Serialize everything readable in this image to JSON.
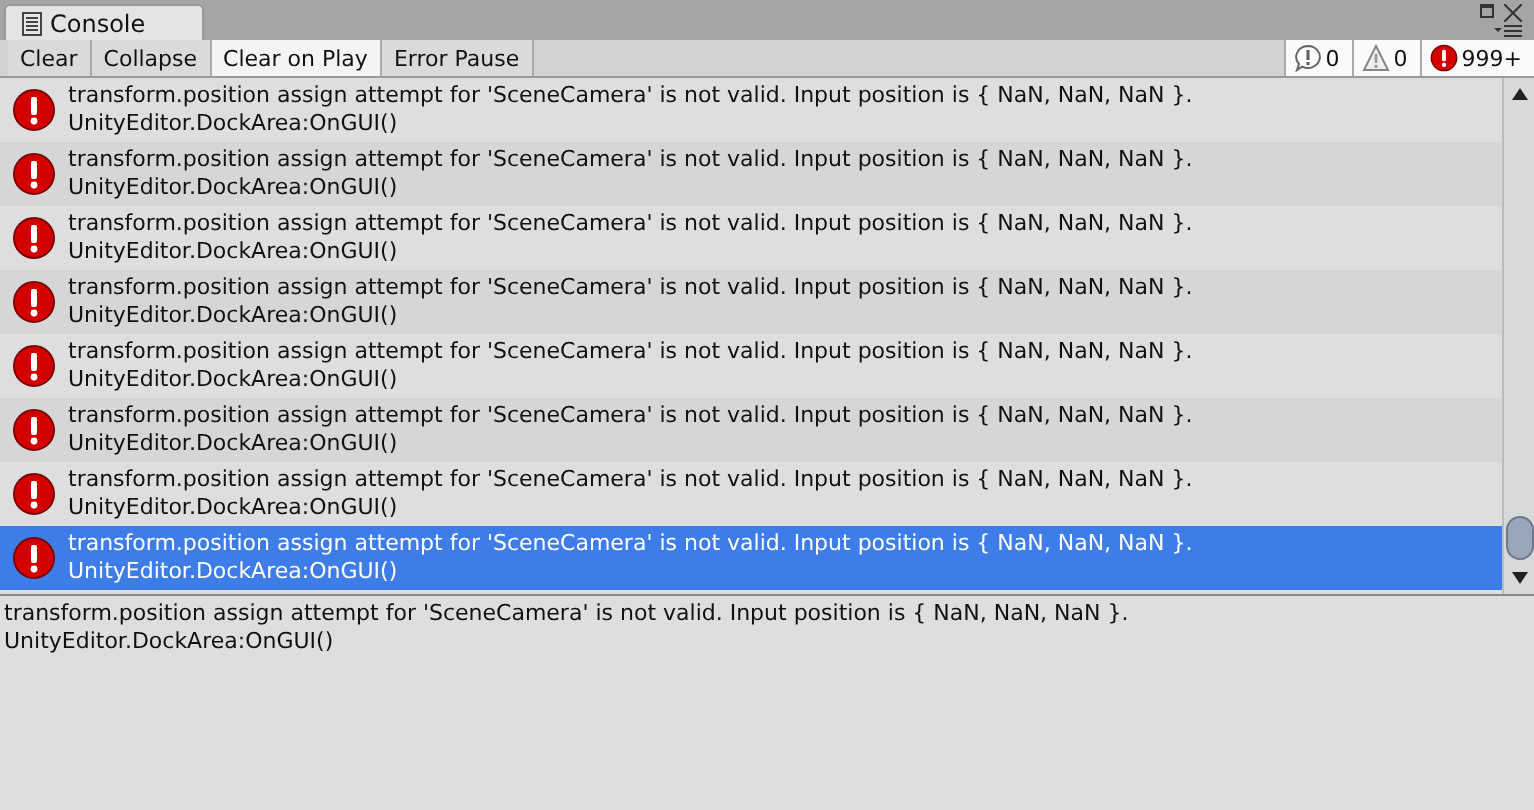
{
  "tab": {
    "title": "Console"
  },
  "toolbar": {
    "buttons": [
      {
        "label": "Clear",
        "selected": false
      },
      {
        "label": "Collapse",
        "selected": false
      },
      {
        "label": "Clear on Play",
        "selected": true
      },
      {
        "label": "Error Pause",
        "selected": false
      }
    ],
    "counters": [
      {
        "kind": "info",
        "count": "0"
      },
      {
        "kind": "warning",
        "count": "0"
      },
      {
        "kind": "error",
        "count": "999+"
      }
    ]
  },
  "entries": [
    {
      "kind": "error",
      "message": "transform.position assign attempt for 'SceneCamera' is not valid. Input position is { NaN, NaN, NaN }.",
      "source": "UnityEditor.DockArea:OnGUI()",
      "selected": false
    },
    {
      "kind": "error",
      "message": "transform.position assign attempt for 'SceneCamera' is not valid. Input position is { NaN, NaN, NaN }.",
      "source": "UnityEditor.DockArea:OnGUI()",
      "selected": false
    },
    {
      "kind": "error",
      "message": "transform.position assign attempt for 'SceneCamera' is not valid. Input position is { NaN, NaN, NaN }.",
      "source": "UnityEditor.DockArea:OnGUI()",
      "selected": false
    },
    {
      "kind": "error",
      "message": "transform.position assign attempt for 'SceneCamera' is not valid. Input position is { NaN, NaN, NaN }.",
      "source": "UnityEditor.DockArea:OnGUI()",
      "selected": false
    },
    {
      "kind": "error",
      "message": "transform.position assign attempt for 'SceneCamera' is not valid. Input position is { NaN, NaN, NaN }.",
      "source": "UnityEditor.DockArea:OnGUI()",
      "selected": false
    },
    {
      "kind": "error",
      "message": "transform.position assign attempt for 'SceneCamera' is not valid. Input position is { NaN, NaN, NaN }.",
      "source": "UnityEditor.DockArea:OnGUI()",
      "selected": false
    },
    {
      "kind": "error",
      "message": "transform.position assign attempt for 'SceneCamera' is not valid. Input position is { NaN, NaN, NaN }.",
      "source": "UnityEditor.DockArea:OnGUI()",
      "selected": false
    },
    {
      "kind": "error",
      "message": "transform.position assign attempt for 'SceneCamera' is not valid. Input position is { NaN, NaN, NaN }.",
      "source": "UnityEditor.DockArea:OnGUI()",
      "selected": true
    }
  ],
  "detail": {
    "message": "transform.position assign attempt for 'SceneCamera' is not valid. Input position is { NaN, NaN, NaN }.",
    "source": "UnityEditor.DockArea:OnGUI()"
  }
}
